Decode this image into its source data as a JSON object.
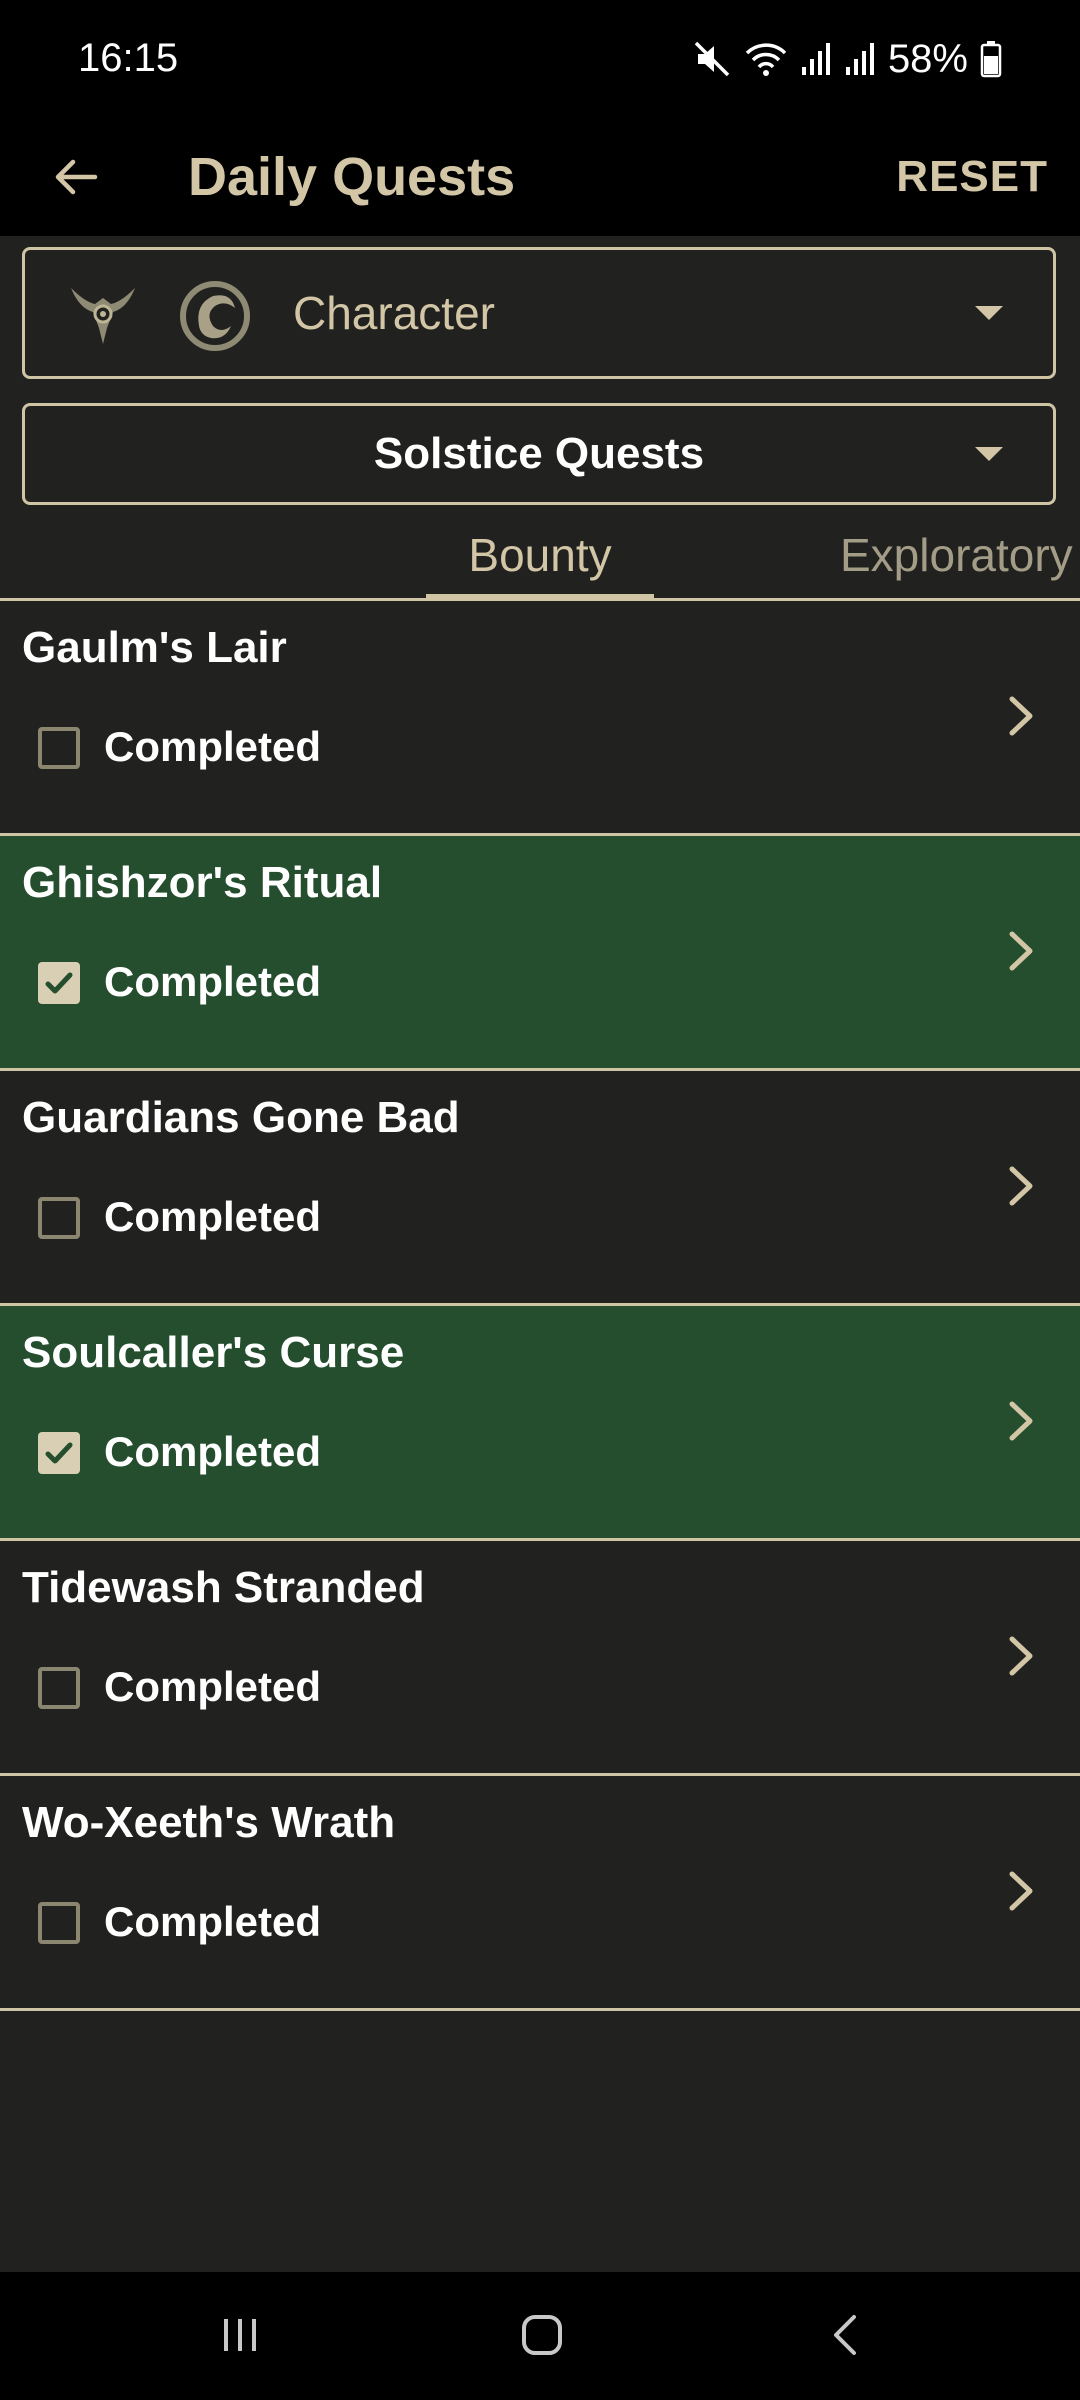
{
  "status_bar": {
    "time": "16:15",
    "battery": "58%",
    "icons": [
      "mute-icon",
      "wifi-icon",
      "signal-icon",
      "signal-icon",
      "battery-icon"
    ]
  },
  "app_bar": {
    "title": "Daily Quests",
    "reset_label": "RESET",
    "back_icon": "arrow-left-icon"
  },
  "character_dropdown": {
    "label": "Character",
    "icons": [
      "faction-emblem-icon",
      "dragon-emblem-icon"
    ]
  },
  "category_dropdown": {
    "label": "Solstice Quests"
  },
  "tabs": [
    {
      "label": "Bounty",
      "active": true
    },
    {
      "label": "Exploratory",
      "active": false
    }
  ],
  "quests": [
    {
      "name": "Gaulm's Lair",
      "status": "Completed",
      "completed": false
    },
    {
      "name": "Ghishzor's Ritual",
      "status": "Completed",
      "completed": true
    },
    {
      "name": "Guardians Gone Bad",
      "status": "Completed",
      "completed": false
    },
    {
      "name": "Soulcaller's Curse",
      "status": "Completed",
      "completed": true
    },
    {
      "name": "Tidewash Stranded",
      "status": "Completed",
      "completed": false
    },
    {
      "name": "Wo-Xeeth's Wrath",
      "status": "Completed",
      "completed": false
    }
  ],
  "colors": {
    "accent": "#d2c6a6",
    "background": "#21211f",
    "completed_row": "#244e2e",
    "app_bar": "#000000"
  }
}
